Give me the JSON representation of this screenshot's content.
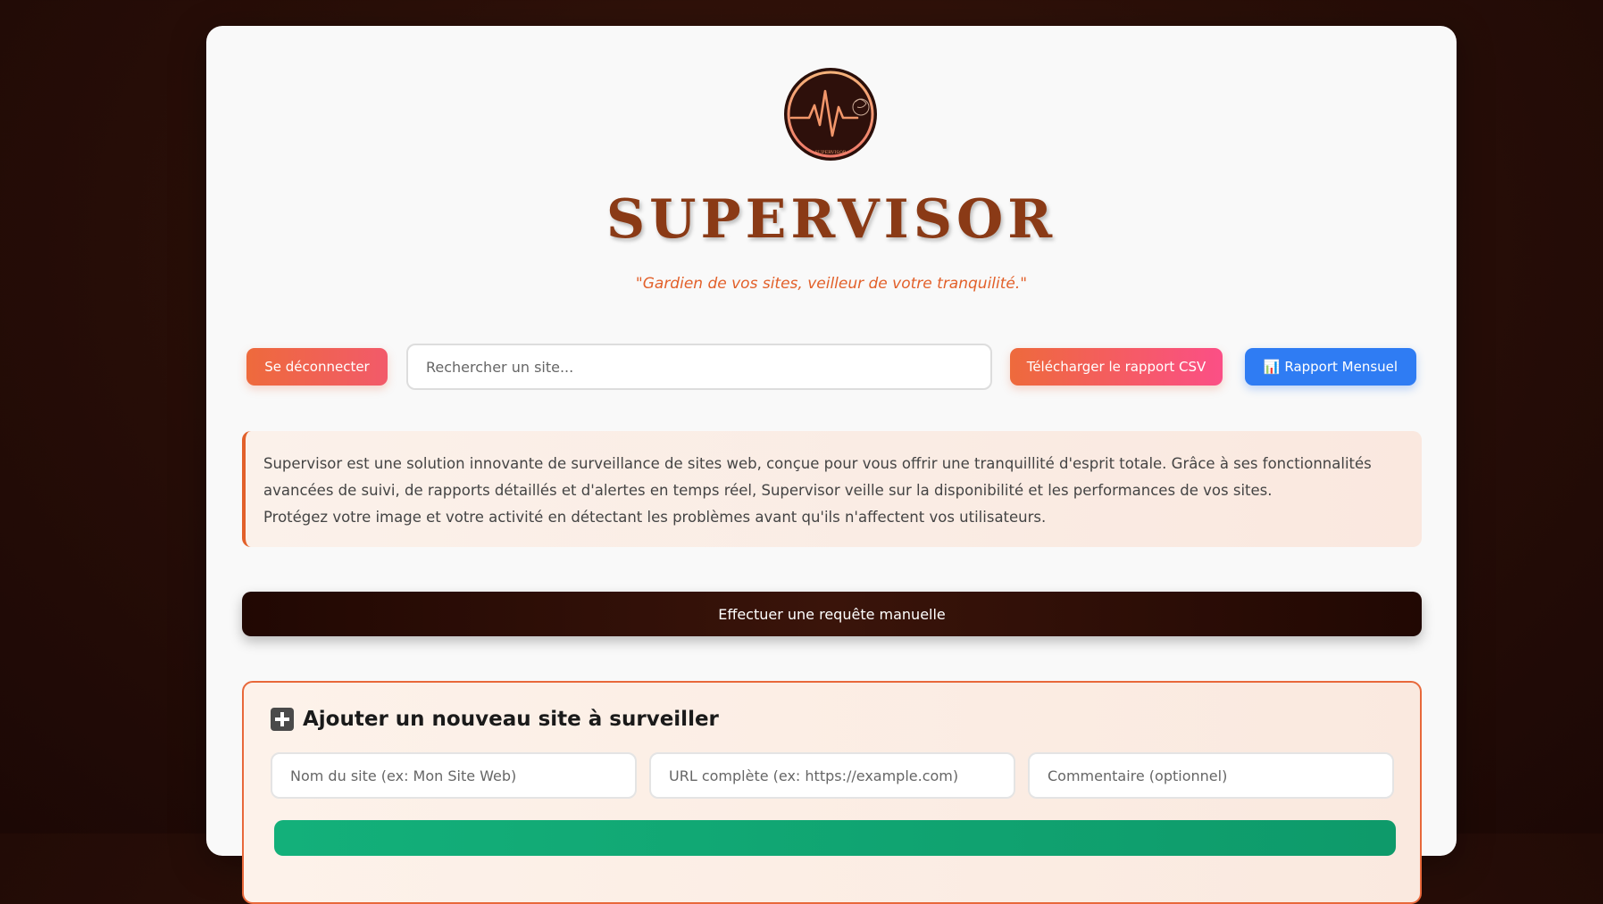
{
  "header": {
    "brand": "SUPERVISOR",
    "tagline": "\"Gardien de vos sites, veilleur de votre tranquilité.\"",
    "logo_text": "SUPERVISOR",
    "logo_icon": "heartbeat-pulse-icon"
  },
  "toolbar": {
    "logout_label": "Se déconnecter",
    "search_placeholder": "Rechercher un site...",
    "csv_label": "Télécharger le rapport CSV",
    "monthly_label": "📊 Rapport Mensuel"
  },
  "about": {
    "paragraph_1": "Supervisor est une solution innovante de surveillance de sites web, conçue pour vous offrir une tranquillité d'esprit totale. Grâce à ses fonctionnalités avancées de suivi, de rapports détaillés et d'alertes en temps réel, Supervisor veille sur la disponibilité et les performances de vos sites.",
    "paragraph_2": "Protégez votre image et votre activité en détectant les problèmes avant qu'ils n'affectent vos utilisateurs."
  },
  "manual_request": {
    "label": "Effectuer une requête manuelle"
  },
  "add_site": {
    "title": "Ajouter un nouveau site à surveiller",
    "name_placeholder": "Nom du site (ex: Mon Site Web)",
    "url_placeholder": "URL complète (ex: https://example.com)",
    "comment_placeholder": "Commentaire (optionnel)"
  },
  "colors": {
    "page_background": "#2a0f08",
    "brand": "#8a3a16",
    "accent": "#e2602a",
    "primary_blue": "#2f7cf3",
    "success_green": "#13b07a"
  }
}
